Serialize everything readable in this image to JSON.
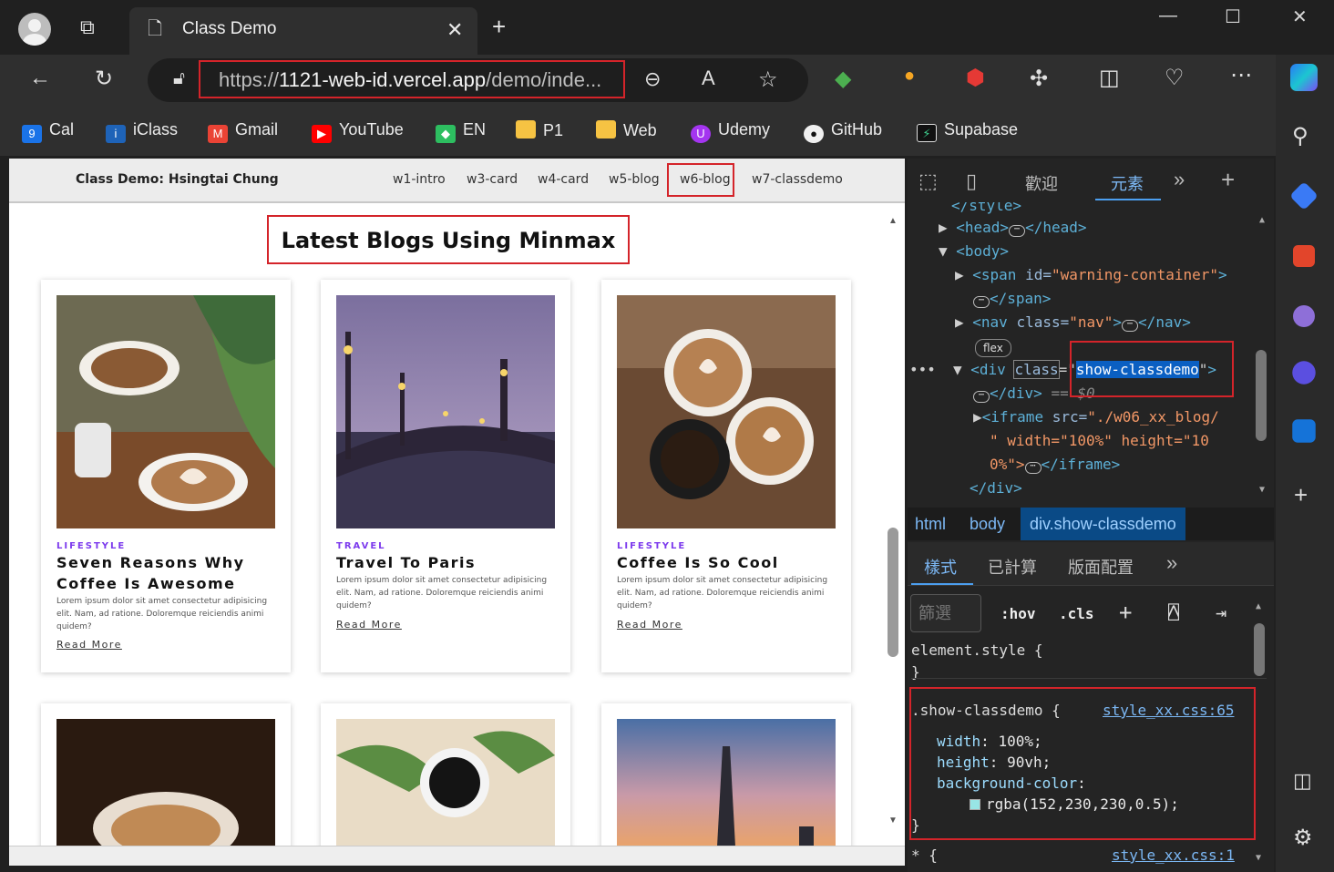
{
  "browser": {
    "tab_title": "Class Demo",
    "url_prefix": "https://",
    "url_host": "1121-web-id.vercel.app",
    "url_path": "/demo/inde...",
    "bookmarks": [
      "Cal",
      "iClass",
      "Gmail",
      "YouTube",
      "EN",
      "P1",
      "Web",
      "Udemy",
      "GitHub",
      "Supabase"
    ]
  },
  "nav": {
    "brand": "Class Demo: Hsingtai Chung",
    "links": [
      "w1-intro",
      "w3-card",
      "w4-card",
      "w5-blog",
      "w6-blog",
      "w7-classdemo"
    ]
  },
  "page": {
    "title": "Latest Blogs Using Minmax",
    "cards": [
      {
        "category": "LIFESTYLE",
        "title": "Seven Reasons Why Coffee Is Awesome",
        "text": "Lorem ipsum dolor sit amet consectetur adipisicing elit. Nam, ad ratione. Doloremque reiciendis animi quidem?",
        "more": "Read More"
      },
      {
        "category": "TRAVEL",
        "title": "Travel To Paris",
        "text": "Lorem ipsum dolor sit amet consectetur adipisicing elit. Nam, ad ratione. Doloremque reiciendis animi quidem?",
        "more": "Read More"
      },
      {
        "category": "LIFESTYLE",
        "title": "Coffee Is So Cool",
        "text": "Lorem ipsum dolor sit amet consectetur adipisicing elit. Nam, ad ratione. Doloremque reiciendis animi quidem?",
        "more": "Read More"
      }
    ]
  },
  "devtools": {
    "tabs": [
      "歡迎",
      "元素"
    ],
    "dom": {
      "style_close": "</style>",
      "head": "<head>",
      "head_close": "</head>",
      "body": "<body>",
      "span_tag": "<span",
      "span_attr": "id=",
      "span_val": "\"warning-container\"",
      "span_close": "</span>",
      "nav_tag": "<nav",
      "nav_attr": "class=",
      "nav_val": "\"nav\"",
      "nav_close": "</nav>",
      "flex_badge": "flex",
      "div_tag": "<div",
      "div_attr": "class",
      "div_val": "show-classdemo",
      "div_close": "</div>",
      "dollar0": "== $0",
      "iframe_tag": "<iframe",
      "iframe_attr": "src=",
      "iframe_val": "\"./w06_xx_blog/",
      "iframe_line2": "\" width=\"100%\" height=\"10",
      "iframe_line3": "0%\">",
      "iframe_close": "</iframe>",
      "div_end": "</div>"
    },
    "breadcrumbs": [
      "html",
      "body",
      "div.show-classdemo"
    ],
    "style_tabs": [
      "樣式",
      "已計算",
      "版面配置"
    ],
    "filter_placeholder": "篩選",
    "hov": ":hov",
    "cls": ".cls",
    "element_style": "element.style {",
    "rule_selector": ".show-classdemo {",
    "rule_source": "style_xx.css:65",
    "props": [
      {
        "name": "width",
        "value": "100%;"
      },
      {
        "name": "height",
        "value": "90vh;"
      },
      {
        "name": "background-color",
        "value": ""
      }
    ],
    "bg_value": "rgba(152,230,230,0.5);",
    "universal": "* {",
    "universal_source": "style_xx.css:1"
  },
  "colors": {
    "highlight": "#d4242a",
    "swatch": "#98e6e6",
    "accent": "#7c3aed"
  }
}
